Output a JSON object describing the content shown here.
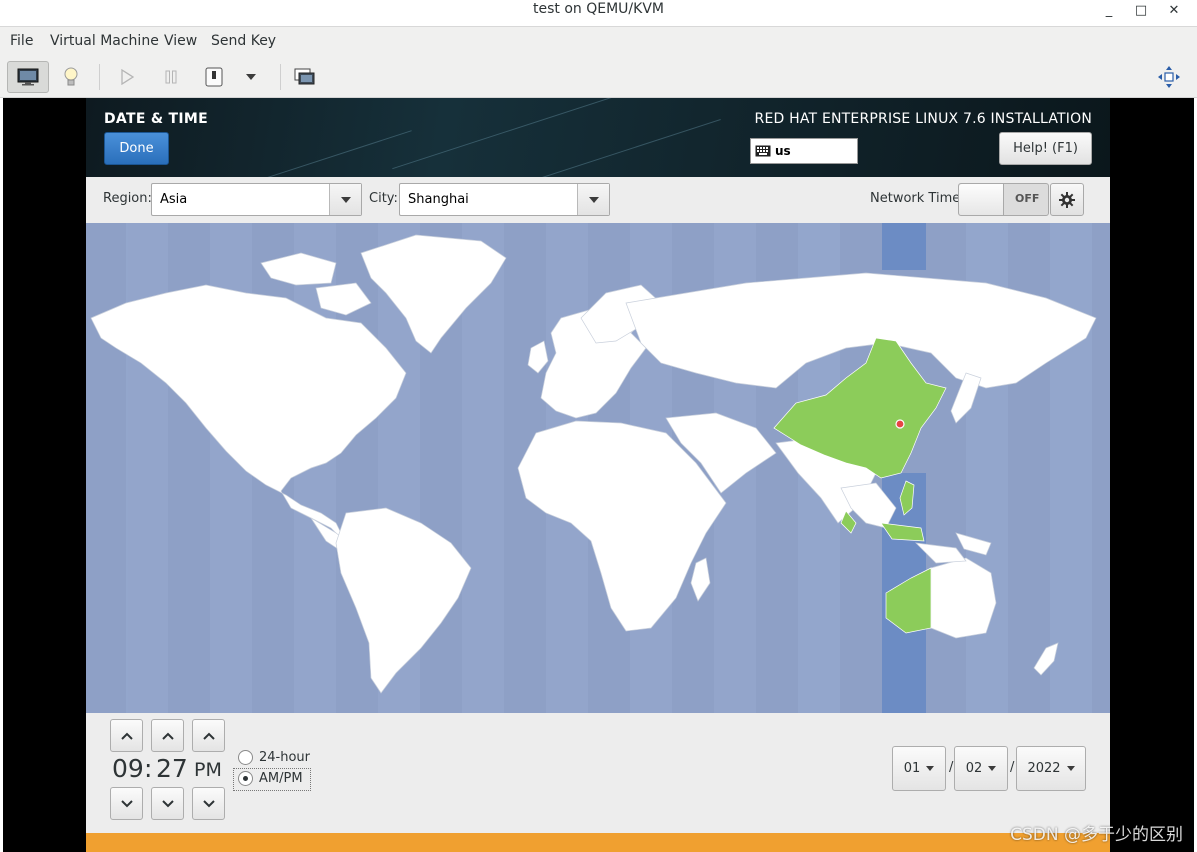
{
  "window": {
    "title": "test on QEMU/KVM",
    "minimize": "_",
    "maximize": "□",
    "close": "✕"
  },
  "menubar": {
    "items": [
      "File",
      "Virtual Machine",
      "View",
      "Send Key"
    ]
  },
  "toolbar": {
    "icons": [
      "monitor-icon",
      "lightbulb-icon",
      "play-icon",
      "pause-icon",
      "power-icon",
      "dropdown-arrow-icon",
      "screenshot-icon",
      "fullscreen-icon"
    ]
  },
  "header": {
    "spoke_title": "DATE & TIME",
    "done_label": "Done",
    "install_title": "RED HAT ENTERPRISE LINUX 7.6 INSTALLATION",
    "keyboard_layout": "us",
    "help_label": "Help! (F1)"
  },
  "selectors": {
    "region_label": "Region:",
    "region_value": "Asia",
    "city_label": "City:",
    "city_value": "Shanghai",
    "network_time_label": "Network Time",
    "network_time_state": "OFF"
  },
  "time": {
    "hours": "09",
    "colon": ":",
    "minutes": "27",
    "ampm": "PM",
    "format_24_label": "24-hour",
    "format_ampm_label": "AM/PM",
    "selected_format": "AM/PM"
  },
  "date": {
    "month": "01",
    "day": "02",
    "year": "2022",
    "separator": "/"
  },
  "watermark": "CSDN @多于少的区别",
  "colors": {
    "ocean": "#8fa2c8",
    "highlight_zone": "#6c8cc4",
    "selected_country": "#8ccc5a",
    "land": "#ffffff",
    "warning": "#f0a030"
  }
}
